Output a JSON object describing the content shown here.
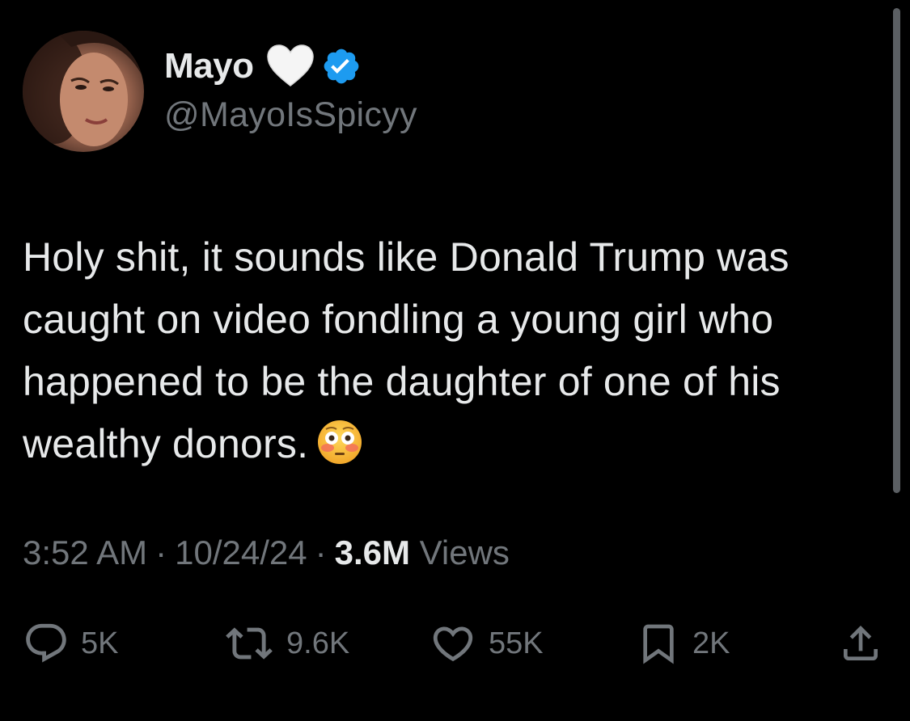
{
  "author": {
    "display_name": "Mayo",
    "handle": "@MayoIsSpicyy",
    "verified": true
  },
  "tweet": {
    "text": "Holy shit, it sounds like Donald Trump was caught on video fondling a young girl who happened to be the daughter of one of his wealthy donors.",
    "emoji": "flushed-face"
  },
  "meta": {
    "time": "3:52 AM",
    "separator": "·",
    "date": "10/24/24",
    "views_count": "3.6M",
    "views_label": "Views"
  },
  "actions": {
    "replies": "5K",
    "reposts": "9.6K",
    "likes": "55K",
    "bookmarks": "2K"
  },
  "colors": {
    "background": "#000000",
    "text_primary": "#e7e9ea",
    "text_secondary": "#71767b",
    "verified_blue": "#1d9bf0"
  },
  "icons": [
    "white-heart-icon",
    "verified-badge-icon",
    "reply-icon",
    "repost-icon",
    "like-icon",
    "bookmark-icon",
    "share-icon"
  ]
}
